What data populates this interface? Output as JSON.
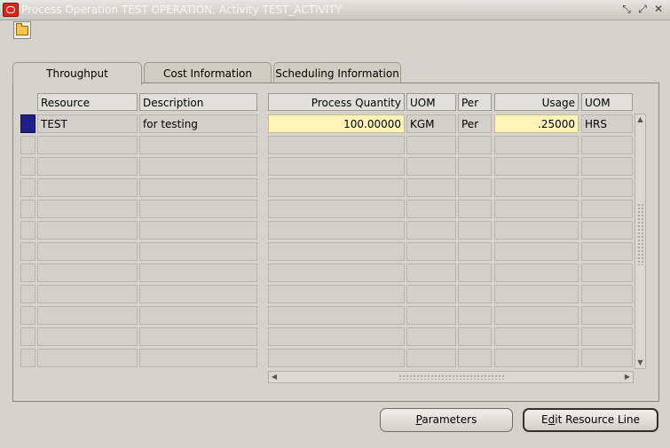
{
  "window": {
    "title": "Process Operation TEST OPERATION, Activity TEST_ACTIVITY",
    "icon": "oracle-logo-icon",
    "controls": [
      "restore-icon",
      "maximize-icon",
      "close-icon"
    ]
  },
  "toolbar": {
    "open_icon": "folder-open-icon"
  },
  "tabs": [
    {
      "label": "Throughput",
      "active": true
    },
    {
      "label": "Cost Information",
      "active": false
    },
    {
      "label": "Scheduling Information",
      "active": false
    }
  ],
  "table": {
    "headers": {
      "resource": "Resource",
      "description": "Description",
      "process_quantity": "Process Quantity",
      "uom1": "UOM",
      "per": "Per",
      "usage": "Usage",
      "uom2": "UOM"
    },
    "rows": [
      {
        "resource": "TEST",
        "description": "for testing",
        "process_quantity": "100.00000",
        "uom1": "KGM",
        "per": "Per",
        "usage": ".25000",
        "uom2": "HRS"
      }
    ],
    "visible_row_count": 12
  },
  "buttons": {
    "parameters_pre": "",
    "parameters_key": "P",
    "parameters_post": "arameters",
    "edit_pre": "E",
    "edit_key": "d",
    "edit_post": "it Resource Line"
  }
}
